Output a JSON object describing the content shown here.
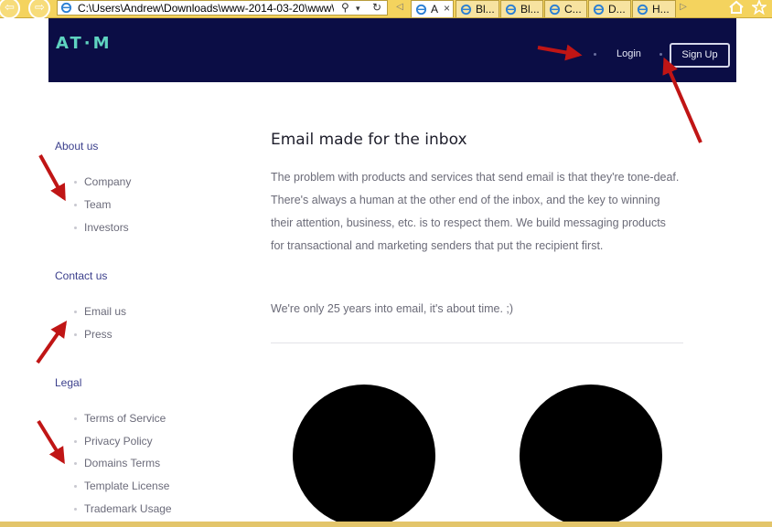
{
  "browser": {
    "address_url": "C:\\Users\\Andrew\\Downloads\\www-2014-03-20\\www\\",
    "tabs": [
      {
        "label": "A",
        "active": true
      },
      {
        "label": "Bl..."
      },
      {
        "label": "Bl..."
      },
      {
        "label": "C..."
      },
      {
        "label": "D..."
      },
      {
        "label": "H..."
      }
    ],
    "close_glyph": "×"
  },
  "header": {
    "logo": "AT·M",
    "login_label": "Login",
    "signup_label": "Sign Up",
    "background": "#0b0d45",
    "accent": "#5fd3c0"
  },
  "sidebar": {
    "sections": [
      {
        "heading": "About us",
        "items": [
          "Company",
          "Team",
          "Investors"
        ]
      },
      {
        "heading": "Contact us",
        "items": [
          "Email us",
          "Press"
        ]
      },
      {
        "heading": "Legal",
        "items": [
          "Terms of Service",
          "Privacy Policy",
          "Domains Terms",
          "Template License",
          "Trademark Usage"
        ]
      }
    ]
  },
  "main": {
    "title": "Email made for the inbox",
    "body": "The problem with products and services that send email is that they're tone-deaf. There's always a human at the other end of the inbox, and the key to winning their attention, business, etc. is to respect them. We build messaging products for transactional and marketing senders that put the recipient first.",
    "tagline": "We're only 25 years into email, it's about time. ;)"
  },
  "annotation_color": "#c01515"
}
